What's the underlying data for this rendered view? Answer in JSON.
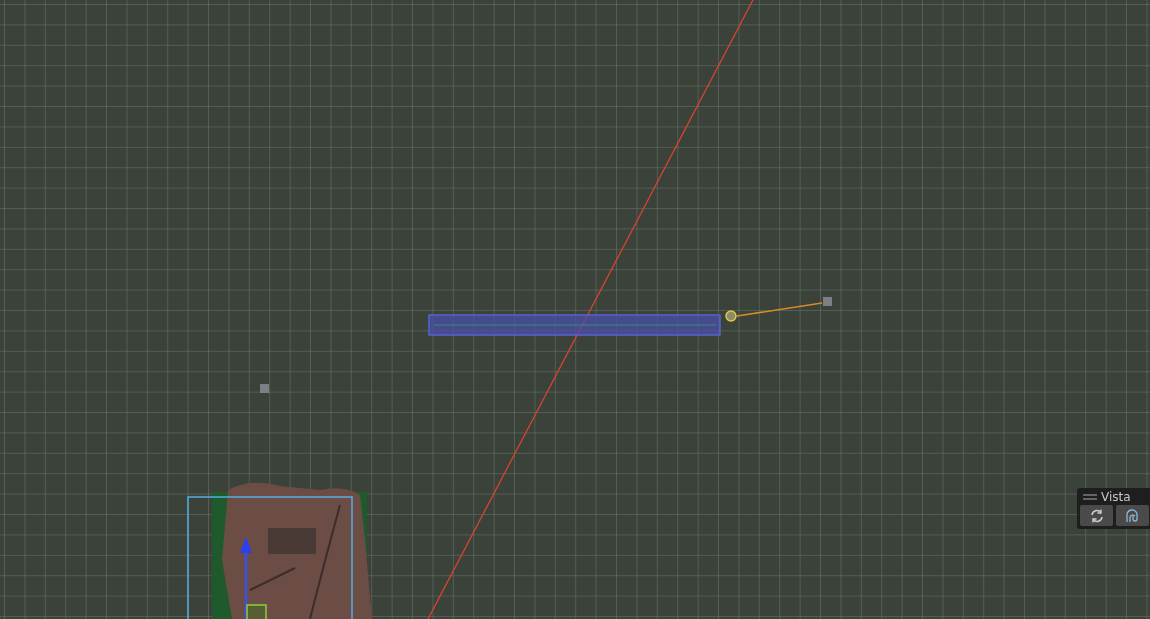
{
  "view_panel": {
    "title": "Vista"
  }
}
